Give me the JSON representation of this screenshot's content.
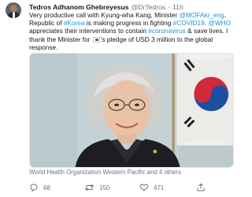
{
  "tweet": {
    "author_name": "Tedros Adhanom Ghebreyesus",
    "author_handle": "@DrTedros",
    "separator": "·",
    "time_ago": "11h",
    "lines": [
      [
        {
          "t": "Very productive call with Kyung-wha Kang, Minister "
        },
        {
          "t": "@MOFAkr_eng",
          "link": true
        },
        {
          "t": "."
        }
      ],
      [
        {
          "t": "Republic of "
        },
        {
          "t": "#Korea",
          "link": true
        },
        {
          "t": " is making progress in fighting "
        },
        {
          "t": "#COVID19",
          "link": true
        },
        {
          "t": ". "
        },
        {
          "t": "@WHO",
          "link": true
        }
      ],
      [
        {
          "t": "appreciates their interventions to contain "
        },
        {
          "t": "#coronavirus",
          "link": true
        },
        {
          "t": " & save lives. I"
        }
      ],
      [
        {
          "t": "thank the Minister for "
        },
        {
          "flag": "south-korea-flag"
        },
        {
          "t": "'s pledge of USD 3 million to the global"
        }
      ],
      [
        {
          "t": "response."
        }
      ]
    ],
    "media_caption": "World Health Organization Western Pacific and 4 others",
    "reply_count": "68",
    "retweet_count": "150",
    "like_count": "471"
  },
  "icons": {
    "reply": "reply-icon",
    "retweet": "retweet-icon",
    "like": "heart-icon",
    "share": "share-icon"
  },
  "colors": {
    "link": "#1b95e0",
    "secondary_text": "#657786",
    "primary_text": "#14171a"
  }
}
